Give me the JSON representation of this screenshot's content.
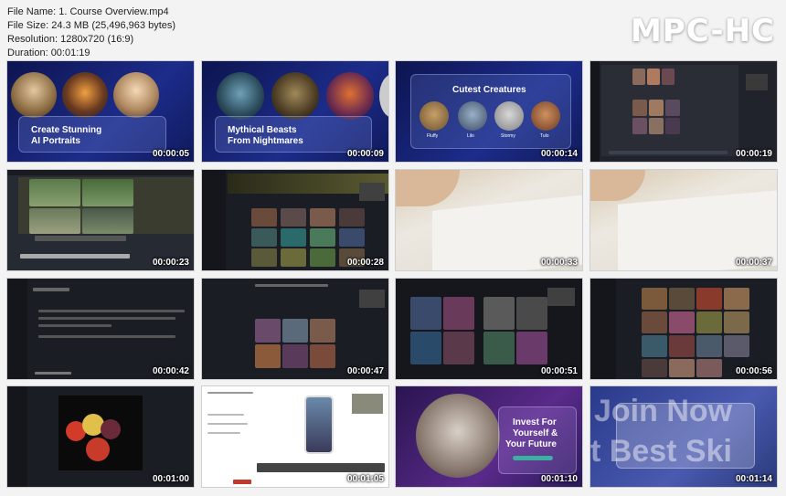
{
  "header": {
    "file_name": "File Name: 1. Course Overview.mp4",
    "file_size": "File Size: 24.3 MB (25,496,963 bytes)",
    "resolution": "Resolution: 1280x720 (16:9)",
    "duration": "Duration: 00:01:19",
    "logo": "MPC-HC"
  },
  "thumbnails": [
    {
      "time": "00:00:05",
      "title1": "Create Stunning",
      "title2": "AI Portraits"
    },
    {
      "time": "00:00:09",
      "title1": "Mythical Beasts",
      "title2": "From Nightmares"
    },
    {
      "time": "00:00:14",
      "title": "Cutest Creatures",
      "names": [
        "Fluffy",
        "Lilo",
        "Stormy",
        "Tulo"
      ]
    },
    {
      "time": "00:00:19"
    },
    {
      "time": "00:00:23"
    },
    {
      "time": "00:00:28"
    },
    {
      "time": "00:00:33"
    },
    {
      "time": "00:00:37"
    },
    {
      "time": "00:00:42"
    },
    {
      "time": "00:00:47"
    },
    {
      "time": "00:00:51"
    },
    {
      "time": "00:00:56"
    },
    {
      "time": "00:01:00"
    },
    {
      "time": "00:01:05"
    },
    {
      "time": "00:01:10",
      "title1": "Invest For",
      "title2": "Yourself &",
      "title3": "Your Future"
    },
    {
      "time": "00:01:14",
      "big1": "Join Now",
      "big2": "t Best Ski"
    }
  ],
  "colors": {
    "accent_navy": "#16206a",
    "dark_ui": "#1b1d24",
    "paper": "#e9e6df"
  }
}
